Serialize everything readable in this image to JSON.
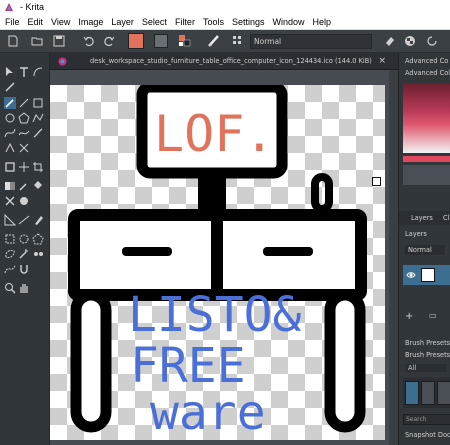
{
  "window": {
    "title": "- Krita"
  },
  "menubar": {
    "items": [
      "File",
      "Edit",
      "View",
      "Image",
      "Layer",
      "Select",
      "Filter",
      "Tools",
      "Settings",
      "Window",
      "Help"
    ]
  },
  "toolbar": {
    "blend_mode": "Normal",
    "foreground_color": "#e0735b"
  },
  "document": {
    "tab_title": "desk_workspace_studio_furniture_table_office_computer_icon_124434.ico (144.0 KiB)",
    "close_label": "×",
    "overlay_text_top": "LOF.",
    "overlay_text_bottom_lines": [
      "LISTO&",
      "FREE",
      "ware"
    ],
    "top_text_color": "#e0735b",
    "bottom_text_color": "#4a6fd6"
  },
  "dock": {
    "advanced_color_title": "Advanced Co",
    "advanced_color_sub": "Advanced Colo",
    "tabs": [
      "Layers",
      "Cl"
    ],
    "layers_label": "Layers",
    "layer_blend": "Normal",
    "brush_presets_title": "Brush Presets",
    "brush_presets_sub": "Brush Presets",
    "filter_value": "All",
    "search_placeholder": "Search",
    "snapshot_label": "Snapshot Docke"
  },
  "colors": {
    "panel_bg": "#31363b",
    "toolbar_bg": "#3b4045",
    "canvas_bg": "#474c52",
    "accent": "#3d6e8f"
  }
}
